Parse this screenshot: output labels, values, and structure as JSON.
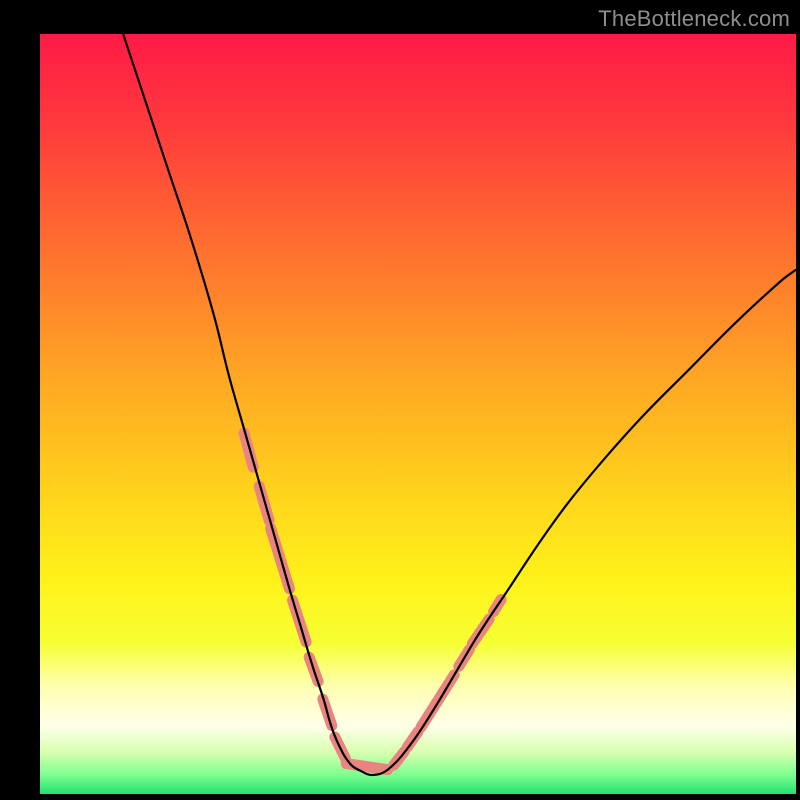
{
  "watermark": {
    "text": "TheBottleneck.com"
  },
  "frame": {
    "border_color": "#000000",
    "inner_left": 40,
    "inner_top": 34,
    "inner_width": 756,
    "inner_height": 760
  },
  "gradient": {
    "stops": [
      {
        "offset": 0.0,
        "color": "#ff1a46"
      },
      {
        "offset": 0.12,
        "color": "#ff3a3d"
      },
      {
        "offset": 0.28,
        "color": "#ff6f2f"
      },
      {
        "offset": 0.45,
        "color": "#ffa624"
      },
      {
        "offset": 0.6,
        "color": "#ffd21c"
      },
      {
        "offset": 0.72,
        "color": "#fff21a"
      },
      {
        "offset": 0.8,
        "color": "#f6ff32"
      },
      {
        "offset": 0.86,
        "color": "#ffffb4"
      },
      {
        "offset": 0.91,
        "color": "#ffffe8"
      },
      {
        "offset": 0.945,
        "color": "#d8ffb0"
      },
      {
        "offset": 0.975,
        "color": "#7dff90"
      },
      {
        "offset": 1.0,
        "color": "#22e06f"
      }
    ]
  },
  "chart_data": {
    "type": "line",
    "title": "",
    "xlabel": "",
    "ylabel": "",
    "xlim": [
      0,
      100
    ],
    "ylim": [
      0,
      100
    ],
    "series": [
      {
        "name": "bottleneck-curve",
        "x": [
          11,
          14,
          17,
          20,
          23,
          25,
          27,
          29,
          31,
          33,
          34.5,
          36,
          37.5,
          38.5,
          39.5,
          41,
          42.5,
          44,
          46,
          49,
          52,
          55,
          58,
          62,
          66,
          70,
          75,
          80,
          86,
          92,
          98,
          100
        ],
        "y": [
          100,
          91,
          82,
          73,
          63,
          55,
          48,
          41,
          34,
          27,
          22,
          17,
          12.5,
          9,
          6.5,
          4,
          3,
          2.5,
          3.2,
          6.5,
          11,
          16,
          21,
          27,
          33,
          38.5,
          44.5,
          50,
          56,
          62,
          67.5,
          69
        ],
        "color": "#000000",
        "width": 2.2
      }
    ],
    "highlight_segments": {
      "color": "#e9847f",
      "width": 11,
      "segments": [
        {
          "x": [
            27.0,
            28.2
          ],
          "y": [
            47.5,
            43.0
          ]
        },
        {
          "x": [
            29.0,
            30.3
          ],
          "y": [
            40.5,
            36.0
          ]
        },
        {
          "x": [
            30.5,
            33.0
          ],
          "y": [
            35.0,
            27.0
          ]
        },
        {
          "x": [
            33.4,
            35.2
          ],
          "y": [
            25.5,
            20.0
          ]
        },
        {
          "x": [
            35.6,
            36.8
          ],
          "y": [
            18.0,
            14.8
          ]
        },
        {
          "x": [
            37.4,
            38.6
          ],
          "y": [
            12.5,
            9.0
          ]
        },
        {
          "x": [
            39.0,
            40.4
          ],
          "y": [
            7.5,
            4.7
          ]
        },
        {
          "x": [
            40.5,
            46.0
          ],
          "y": [
            4.0,
            3.2
          ]
        },
        {
          "x": [
            46.8,
            48.2
          ],
          "y": [
            3.8,
            5.6
          ]
        },
        {
          "x": [
            48.6,
            50.0
          ],
          "y": [
            6.2,
            8.2
          ]
        },
        {
          "x": [
            50.4,
            54.8
          ],
          "y": [
            8.8,
            15.7
          ]
        },
        {
          "x": [
            55.4,
            56.8
          ],
          "y": [
            16.8,
            19.0
          ]
        },
        {
          "x": [
            57.2,
            59.4
          ],
          "y": [
            19.8,
            23.0
          ]
        },
        {
          "x": [
            60.0,
            61.0
          ],
          "y": [
            24.0,
            25.6
          ]
        }
      ]
    }
  }
}
